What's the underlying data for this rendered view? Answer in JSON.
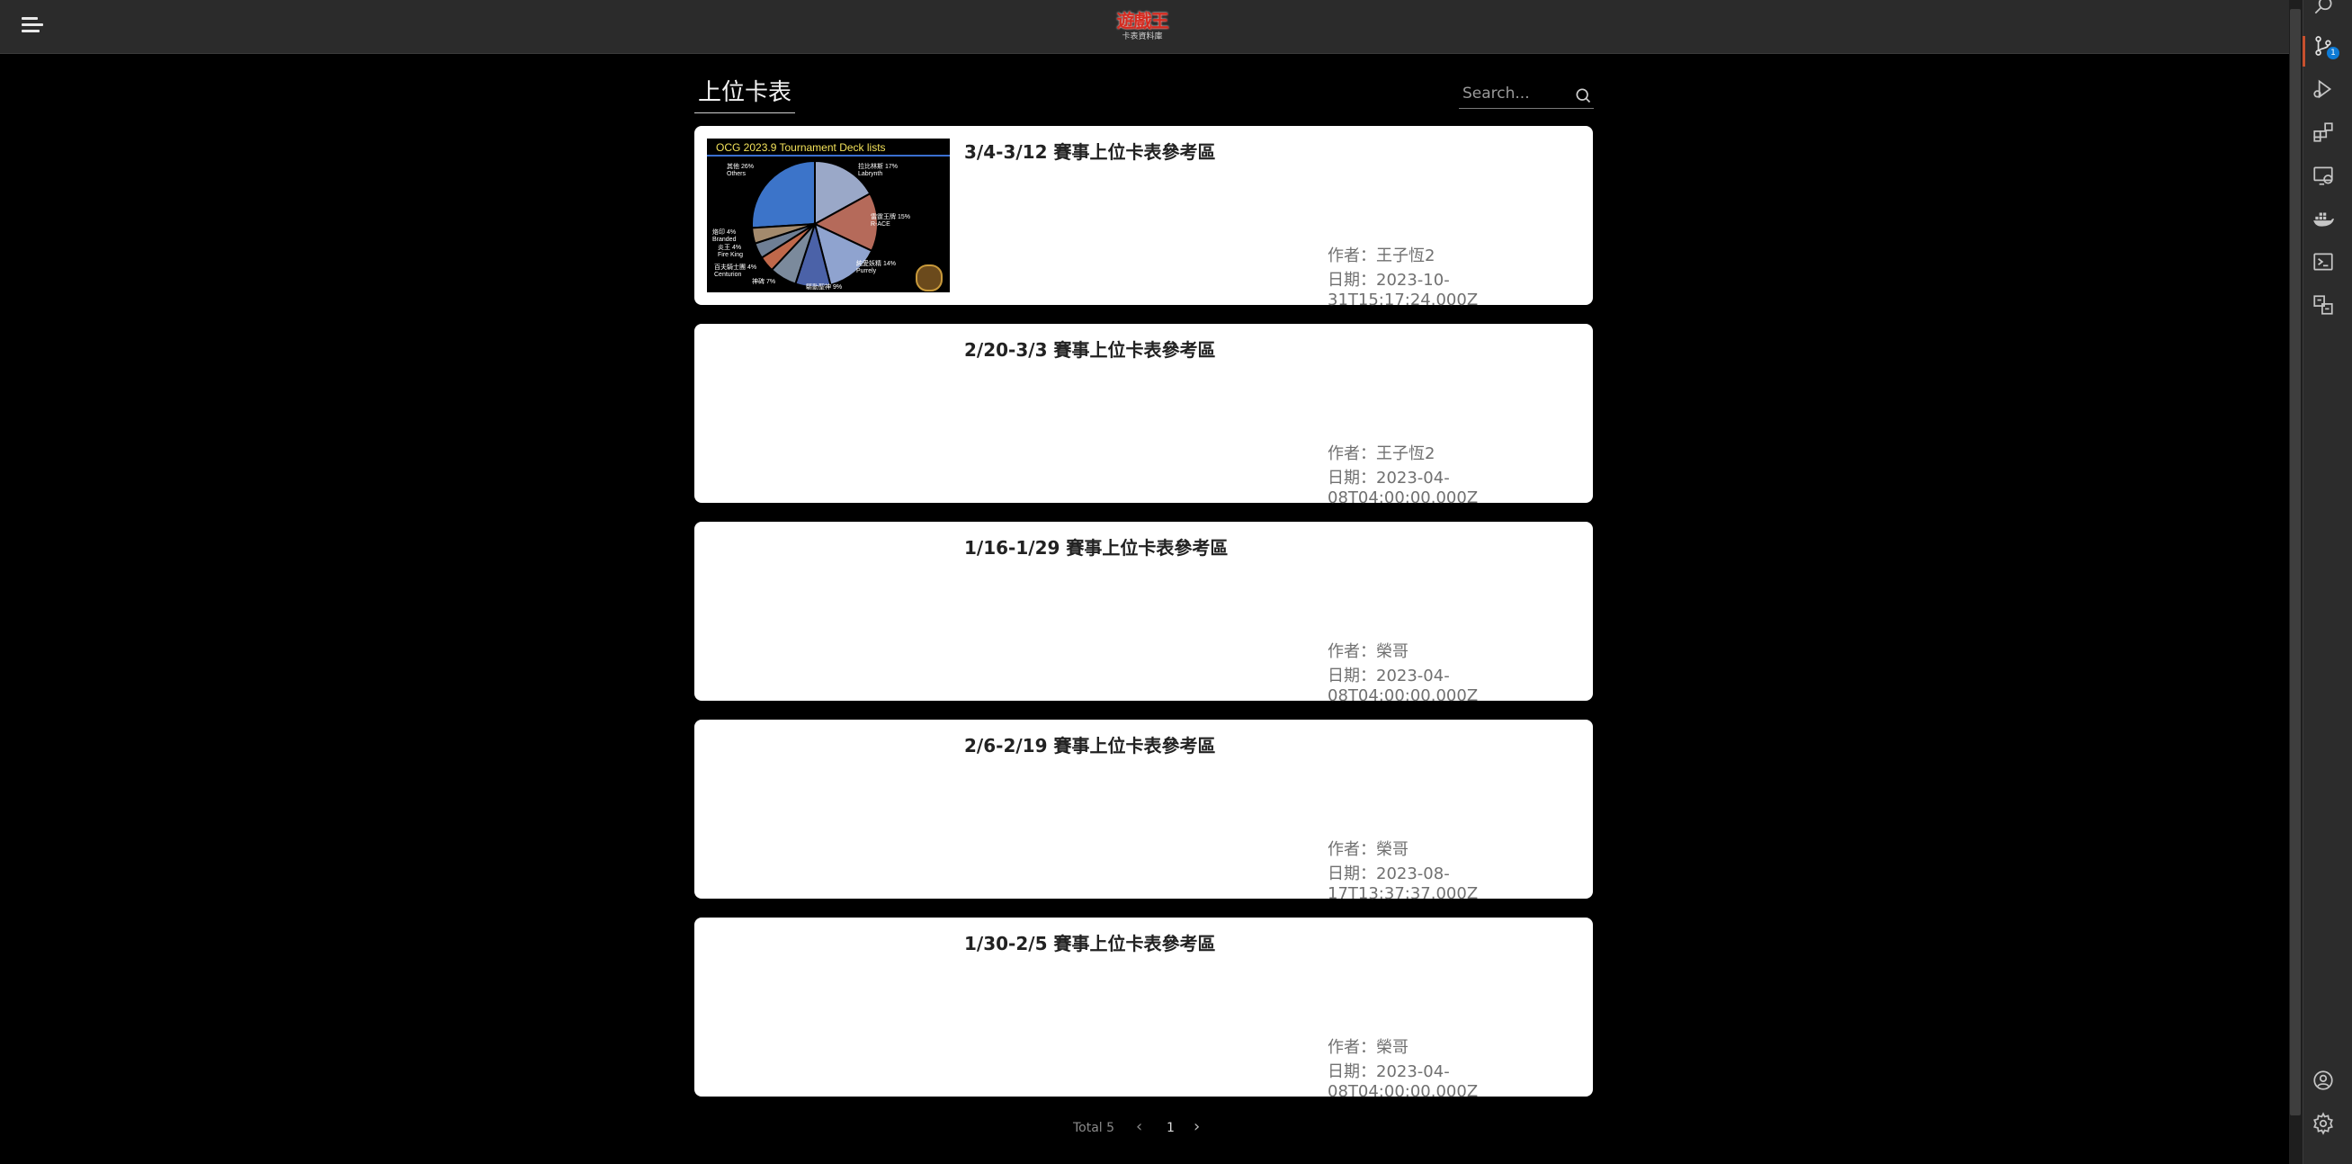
{
  "header": {
    "logo_text": "遊戲王",
    "logo_subtext": "卡表資料庫"
  },
  "page": {
    "title": "上位卡表",
    "search_placeholder": "Search..."
  },
  "posts": [
    {
      "title": "3/4-3/12 賽事上位卡表參考區",
      "author": "作者：王子恆2",
      "date": "日期：2023-10-31T15:17:24.000Z",
      "has_thumbnail": true
    },
    {
      "title": "2/20-3/3 賽事上位卡表參考區",
      "author": "作者：王子恆2",
      "date": "日期：2023-04-08T04:00:00.000Z",
      "has_thumbnail": false
    },
    {
      "title": "1/16-1/29 賽事上位卡表參考區",
      "author": "作者：榮哥",
      "date": "日期：2023-04-08T04:00:00.000Z",
      "has_thumbnail": false
    },
    {
      "title": "2/6-2/19 賽事上位卡表參考區",
      "author": "作者：榮哥",
      "date": "日期：2023-08-17T13:37:37.000Z",
      "has_thumbnail": false
    },
    {
      "title": "1/30-2/5 賽事上位卡表參考區",
      "author": "作者：榮哥",
      "date": "日期：2023-04-08T04:00:00.000Z",
      "has_thumbnail": false
    }
  ],
  "thumbnail": {
    "title": "OCG 2023.9  Tournament Deck lists",
    "slices": [
      {
        "name": "其他 26%\nOthers",
        "percent": 26,
        "color": "#3c74c9"
      },
      {
        "name": "拉比林斯 17%\nLabrynth",
        "percent": 17,
        "color": "#9aa8c8"
      },
      {
        "name": "雷霆王牌 15%\nR-ACE",
        "percent": 15,
        "color": "#b56a5a"
      },
      {
        "name": "純愛妖精 14%\nPurrely",
        "percent": 14,
        "color": "#8fa3cf"
      },
      {
        "name": "驅動聖神 9%",
        "percent": 9,
        "color": "#4b62a8"
      },
      {
        "name": "神碑 7%",
        "percent": 7,
        "color": "#7b8a9c"
      },
      {
        "name": "炎王 4%\nFire King",
        "percent": 4,
        "color": "#c0684a"
      },
      {
        "name": "百夫騎士團 4%\nCenturion",
        "percent": 4,
        "color": "#6f7f95"
      },
      {
        "name": "烙印 4%\nBranded",
        "percent": 4,
        "color": "#a38a6d"
      }
    ]
  },
  "pagination": {
    "total_text": "Total 5",
    "current_page": "1",
    "prev_symbol": "‹",
    "next_symbol": "›"
  },
  "activitybar": {
    "icons": [
      "search-icon",
      "source-control-icon",
      "run-debug-icon",
      "extensions-icon",
      "remote-explorer-icon",
      "docker-icon",
      "terminal-icon",
      "translate-icon",
      "account-icon",
      "settings-gear-icon"
    ],
    "badge_count": "1"
  }
}
